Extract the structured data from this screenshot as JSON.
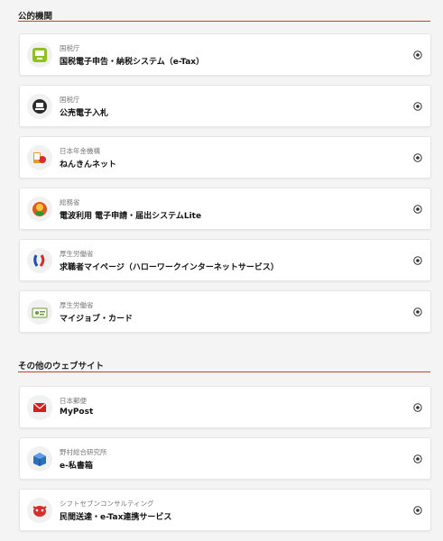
{
  "sections": [
    {
      "title": "公的機関",
      "items": [
        {
          "org": "国税庁",
          "service": "国税電子申告・納税システム（e-Tax）",
          "icon": "etax-icon"
        },
        {
          "org": "国税庁",
          "service": "公売電子入札",
          "icon": "auction-icon"
        },
        {
          "org": "日本年金機構",
          "service": "ねんきんネット",
          "icon": "nenkin-icon"
        },
        {
          "org": "総務省",
          "service": "電波利用 電子申請・届出システムLite",
          "icon": "radio-mascot-icon"
        },
        {
          "org": "厚生労働省",
          "service": "求職者マイページ（ハローワークインターネットサービス）",
          "icon": "hellowork-icon"
        },
        {
          "org": "厚生労働省",
          "service": "マイジョブ・カード",
          "icon": "jobcard-icon"
        }
      ]
    },
    {
      "title": "その他のウェブサイト",
      "items": [
        {
          "org": "日本郵便",
          "service": "MyPost",
          "icon": "mypost-icon"
        },
        {
          "org": "野村総合研究所",
          "service": "e-私書箱",
          "icon": "shishobako-icon"
        },
        {
          "org": "シフトセブンコンサルティング",
          "service": "民間送達・e-Tax連携サービス",
          "icon": "cow-mascot-icon"
        }
      ]
    }
  ],
  "colors": {
    "accent_rule": "#c0461c",
    "etax_green": "#8ec31f",
    "mypost_red": "#d6201f",
    "shishobako_blue": "#2a6fb7"
  },
  "expand_icon": "plus-circle-icon"
}
